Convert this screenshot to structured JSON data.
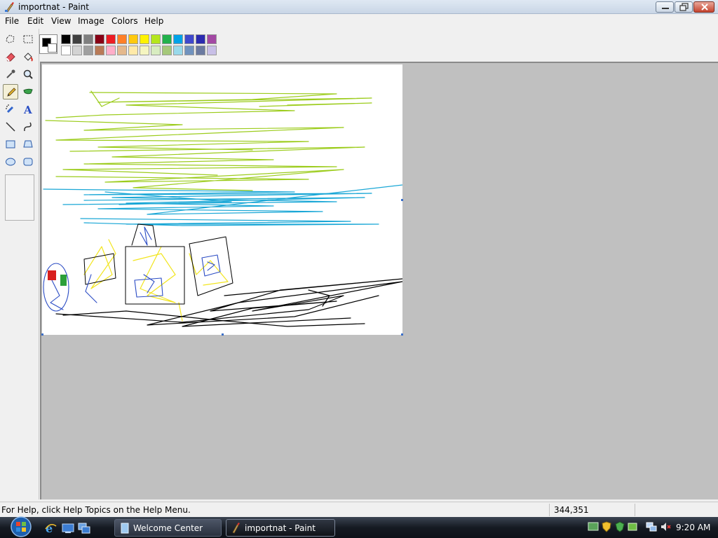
{
  "window": {
    "title": "importnat - Paint",
    "app_icon": "paint-icon",
    "controls": [
      "minimize-icon",
      "maximize-icon",
      "close-icon"
    ]
  },
  "menu": {
    "items": [
      {
        "label": "File"
      },
      {
        "label": "Edit"
      },
      {
        "label": "View"
      },
      {
        "label": "Image"
      },
      {
        "label": "Colors"
      },
      {
        "label": "Help"
      }
    ]
  },
  "toolbox": {
    "tools": [
      {
        "name": "free-form-select",
        "icon": "free-select-icon"
      },
      {
        "name": "select",
        "icon": "rect-select-icon"
      },
      {
        "name": "eraser",
        "icon": "eraser-icon"
      },
      {
        "name": "fill",
        "icon": "fill-bucket-icon"
      },
      {
        "name": "pick-color",
        "icon": "eyedropper-icon"
      },
      {
        "name": "magnifier",
        "icon": "magnifier-icon"
      },
      {
        "name": "pencil",
        "icon": "pencil-icon",
        "selected": true
      },
      {
        "name": "brush",
        "icon": "brush-icon"
      },
      {
        "name": "airbrush",
        "icon": "airbrush-icon"
      },
      {
        "name": "text",
        "icon": "text-icon"
      },
      {
        "name": "line",
        "icon": "line-icon"
      },
      {
        "name": "curve",
        "icon": "curve-icon"
      },
      {
        "name": "rectangle",
        "icon": "rectangle-icon"
      },
      {
        "name": "polygon",
        "icon": "polygon-icon"
      },
      {
        "name": "ellipse",
        "icon": "ellipse-icon"
      },
      {
        "name": "rounded-rectangle",
        "icon": "rounded-rect-icon"
      }
    ]
  },
  "palette": {
    "primary": "#000000",
    "secondary": "#ffffff",
    "top_row": [
      "#000000",
      "#404040",
      "#7f7f7f",
      "#880015",
      "#ed1c24",
      "#ff7f27",
      "#ffc90e",
      "#fff200",
      "#b5e61d",
      "#22b14c",
      "#00a2e8",
      "#3f48cc",
      "#2b2bb0",
      "#a349a4"
    ],
    "bottom_row": [
      "#ffffff",
      "#d3d3d3",
      "#a0a0a0",
      "#b97a57",
      "#ffaec9",
      "#e4b88c",
      "#ffe9a8",
      "#f5f5c0",
      "#d8ecc0",
      "#a5c87a",
      "#99d9ea",
      "#7092be",
      "#6b7aa0",
      "#c8bfe7"
    ]
  },
  "drawing_colors": {
    "lime": "#9ccc1c",
    "cyan": "#1aa7d6",
    "yellow": "#f2e51f",
    "black": "#000000",
    "blue": "#2a4bc4",
    "red": "#d81e1e",
    "green": "#2ca03a"
  },
  "status": {
    "help_text": "For Help, click Help Topics on the Help Menu.",
    "coords": "344,351"
  },
  "taskbar": {
    "start": "windows-start-orb",
    "quick_launch": [
      "internet-explorer-icon",
      "show-desktop-icon",
      "switch-windows-icon"
    ],
    "tasks": [
      {
        "label": "Welcome Center",
        "icon": "welcome-center-icon"
      },
      {
        "label": "importnat - Paint",
        "icon": "paint-icon",
        "active": true
      }
    ],
    "tray_icons": [
      "network-monitor-icon",
      "security-shield-icon",
      "defender-icon",
      "sync-icon",
      "network-icon",
      "volume-muted-icon"
    ],
    "clock": "9:20 AM"
  }
}
